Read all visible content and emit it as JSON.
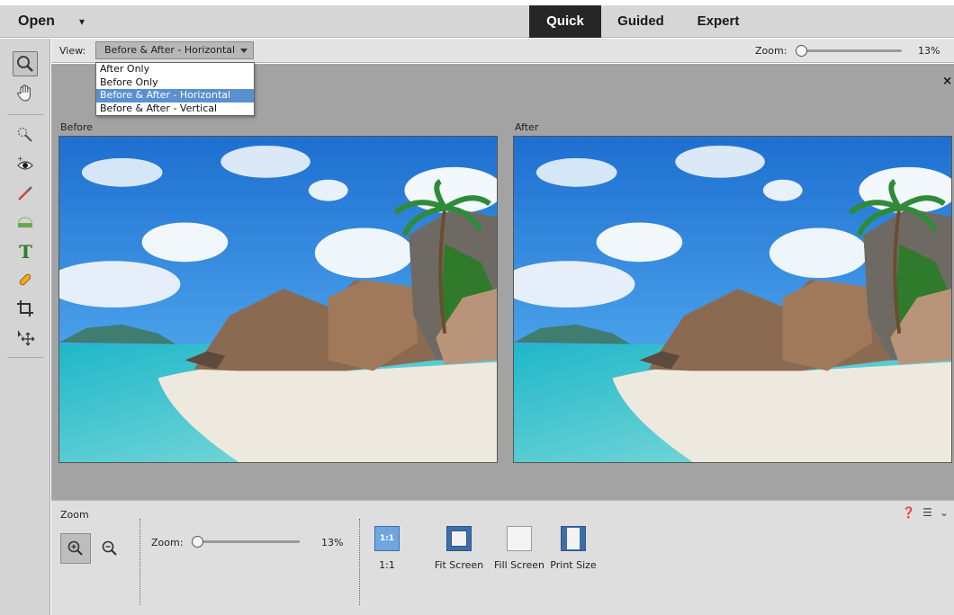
{
  "topbar": {
    "open_label": "Open",
    "open_caret": "▾",
    "tabs": [
      {
        "label": "Quick",
        "active": true
      },
      {
        "label": "Guided",
        "active": false
      },
      {
        "label": "Expert",
        "active": false
      }
    ]
  },
  "toolbar": {
    "tools": [
      "zoom-icon",
      "hand-icon",
      "quick-selection-icon",
      "red-eye-icon",
      "whiten-teeth-icon",
      "straighten-icon",
      "type-icon",
      "spot-healing-icon",
      "crop-icon",
      "move-icon"
    ]
  },
  "options": {
    "view_label": "View:",
    "view_value": "Before & After - Horizontal",
    "zoom_label": "Zoom:",
    "zoom_value": "13%"
  },
  "view_dropdown": {
    "items": [
      "After Only",
      "Before Only",
      "Before & After - Horizontal",
      "Before & After - Vertical"
    ],
    "selected_index": 2
  },
  "workspace": {
    "close_glyph": "×",
    "before_label": "Before",
    "after_label": "After"
  },
  "panel": {
    "title": "Zoom",
    "help_glyph": "❓",
    "menu_glyph": "☰",
    "collapse_glyph": "⌄",
    "zoom_label": "Zoom:",
    "zoom_value": "13%",
    "view_options": [
      {
        "icon_text": "1:1",
        "label": "1:1"
      },
      {
        "label": "Fit Screen"
      },
      {
        "label": "Fill Screen"
      },
      {
        "label": "Print Size"
      }
    ]
  },
  "colors": {
    "active_tab_bg": "#262626",
    "selection_blue": "#5a8fd0"
  }
}
